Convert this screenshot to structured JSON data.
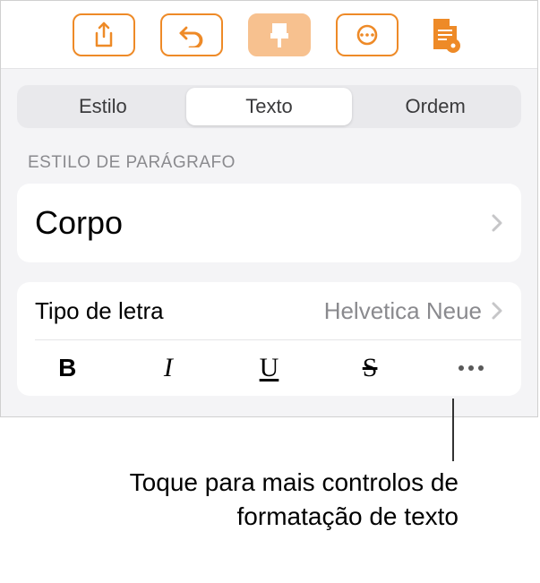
{
  "toolbar": {
    "icons": {
      "share": "share-icon",
      "undo": "undo-icon",
      "format": "format-brush-icon",
      "more": "more-icon",
      "document": "document-view-icon"
    }
  },
  "segmented": {
    "items": [
      {
        "label": "Estilo",
        "selected": false
      },
      {
        "label": "Texto",
        "selected": true
      },
      {
        "label": "Ordem",
        "selected": false
      }
    ]
  },
  "paragraph_style": {
    "header": "ESTILO DE PARÁGRAFO",
    "value": "Corpo"
  },
  "font": {
    "label": "Tipo de letra",
    "value": "Helvetica Neue",
    "styles": {
      "bold": "B",
      "italic": "I",
      "underline": "U",
      "strike": "S"
    }
  },
  "callout": {
    "text": "Toque para mais controlos de formatação de texto"
  }
}
